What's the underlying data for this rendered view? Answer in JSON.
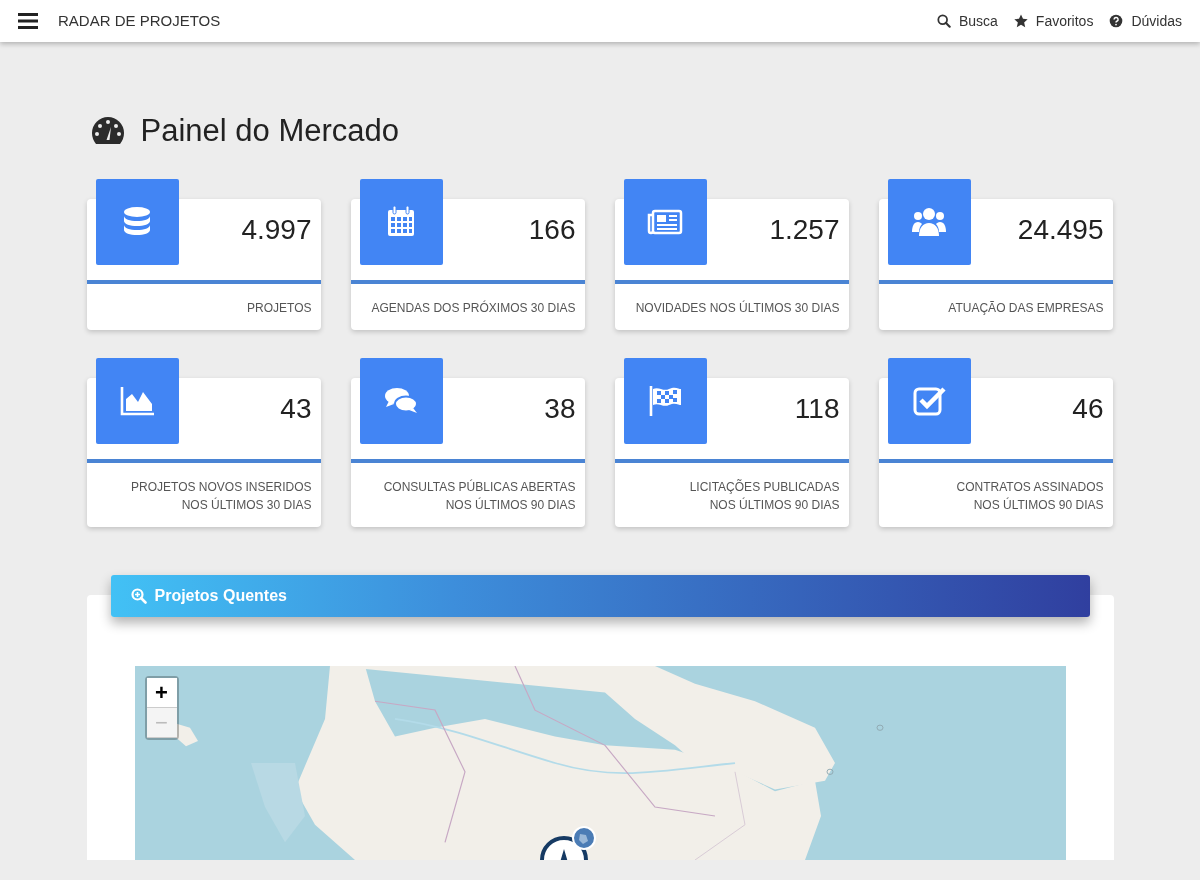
{
  "navbar": {
    "brand": "RADAR DE PROJETOS",
    "links": [
      {
        "label": "Busca"
      },
      {
        "label": "Favoritos"
      },
      {
        "label": "Dúvidas"
      }
    ]
  },
  "page_title": "Painel do Mercado",
  "stats": [
    {
      "value": "4.997",
      "lines": [
        "PROJETOS"
      ]
    },
    {
      "value": "166",
      "lines": [
        "AGENDAS DOS PRÓXIMOS 30 DIAS"
      ]
    },
    {
      "value": "1.257",
      "lines": [
        "NOVIDADES NOS ÚLTIMOS 30 DIAS"
      ]
    },
    {
      "value": "24.495",
      "lines": [
        "ATUAÇÃO DAS EMPRESAS"
      ]
    },
    {
      "value": "43",
      "lines": [
        "PROJETOS NOVOS INSERIDOS",
        "NOS ÚLTIMOS 30 DIAS"
      ]
    },
    {
      "value": "38",
      "lines": [
        "CONSULTAS PÚBLICAS ABERTAS",
        "NOS ÚLTIMOS 90 DIAS"
      ]
    },
    {
      "value": "118",
      "lines": [
        "LICITAÇÕES PUBLICADAS",
        "NOS ÚLTIMOS 90 DIAS"
      ]
    },
    {
      "value": "46",
      "lines": [
        "CONTRATOS ASSINADOS",
        "NOS ÚLTIMOS 90 DIAS"
      ]
    }
  ],
  "panel": {
    "title": "Projetos Quentes",
    "map": {
      "zoom_controls": [
        {
          "label": "+",
          "disabled": false
        },
        {
          "label": "−",
          "disabled": true
        }
      ]
    }
  }
}
